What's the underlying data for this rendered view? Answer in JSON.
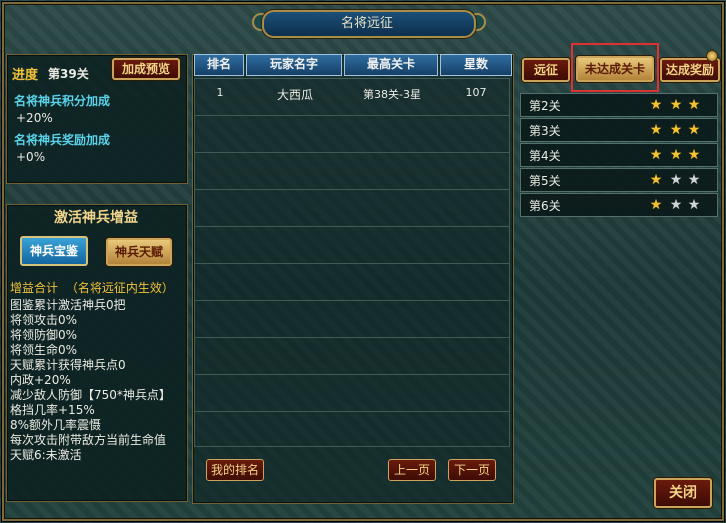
{
  "window": {
    "title": "名将远征"
  },
  "left": {
    "progress_label": "进度",
    "progress_value": "第39关",
    "preview_button": "加成预览",
    "score_bonus_label": "名将神兵积分加成",
    "score_bonus_value": "+20%",
    "reward_bonus_label": "名将神兵奖励加成",
    "reward_bonus_value": "+0%"
  },
  "buff": {
    "title": "激活神兵增益",
    "btn_book": "神兵宝鉴",
    "btn_talent": "神兵天赋",
    "summary_label": "增益合计",
    "summary_note": "（名将远征内生效）",
    "lines": [
      "图鉴累计激活神兵0把",
      "将领攻击0%",
      "将领防御0%",
      "将领生命0%",
      "天赋累计获得神兵点0",
      "内政+20%",
      "减少敌人防御【750*神兵点】",
      "格挡几率+15%",
      "8%额外几率震慑",
      "每次攻击附带敌方当前生命值",
      "天赋6:未激活"
    ]
  },
  "ranking": {
    "headers": [
      "排名",
      "玩家名字",
      "最高关卡",
      "星数"
    ],
    "rows": [
      [
        "1",
        "大西瓜",
        "第38关-3星",
        "107"
      ]
    ],
    "my_rank_button": "我的排名",
    "prev_button": "上一页",
    "next_button": "下一页"
  },
  "right": {
    "tabs": [
      "远征",
      "未达成关卡",
      "达成奖励"
    ],
    "stages": [
      {
        "label": "第2关",
        "stars": 3
      },
      {
        "label": "第3关",
        "stars": 3
      },
      {
        "label": "第4关",
        "stars": 3
      },
      {
        "label": "第5关",
        "stars": 1
      },
      {
        "label": "第6关",
        "stars": 1
      }
    ],
    "max_stars": 3
  },
  "footer": {
    "close_button": "关闭"
  },
  "colors": {
    "highlight": "#e03131",
    "accent_gold": "#c9a45a",
    "cyan_text": "#59d3ea"
  }
}
